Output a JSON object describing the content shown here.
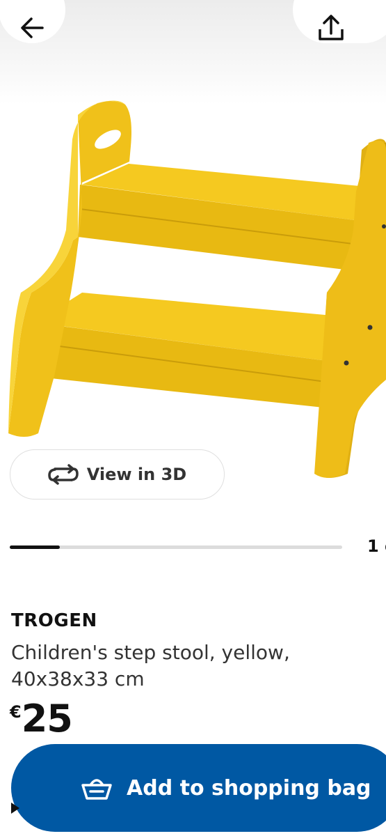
{
  "header": {
    "back_icon": "arrow-left-icon",
    "share_icon": "share-upload-icon"
  },
  "hero": {
    "image": "yellow-childrens-step-stool",
    "accent_color": "#f2c40f"
  },
  "view_3d": {
    "icon": "rotate-3d-icon",
    "label": "View in 3D"
  },
  "gallery": {
    "progress": 0.15,
    "counter": "1 o"
  },
  "product": {
    "name": "TROGEN",
    "description": "Children's step stool, yellow, 40x38x33 cm",
    "price_currency": "€",
    "price_value": "25"
  },
  "cta": {
    "label": "Add to shopping bag",
    "icon": "shopping-bag-icon",
    "color": "#0058a3"
  }
}
